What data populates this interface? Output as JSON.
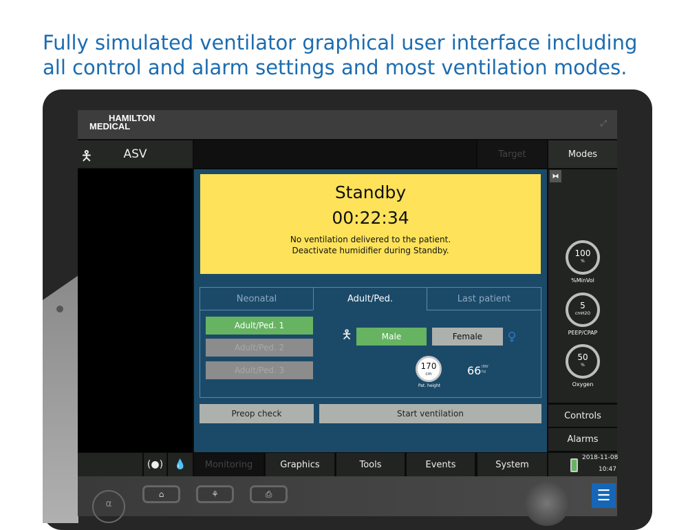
{
  "headline": "Fully simulated ventilator graphical user interface including all control and alarm settings and most ventilation modes.",
  "logo": {
    "line1": "HAMILTON",
    "line2": "MEDICAL"
  },
  "topbar": {
    "mode": "ASV",
    "target": "Target",
    "modes": "Modes"
  },
  "standby": {
    "title": "Standby",
    "timer": "00:22:34",
    "msg1": "No ventilation delivered to the patient.",
    "msg2": "Deactivate humidifier during Standby."
  },
  "tabs": [
    "Neonatal",
    "Adult/Ped.",
    "Last patient"
  ],
  "presets": [
    "Adult/Ped. 1",
    "Adult/Ped. 2",
    "Adult/Ped. 3"
  ],
  "gender": {
    "male": "Male",
    "female": "Female"
  },
  "height": {
    "value": "170",
    "unit": "cm",
    "label": "Pat. height"
  },
  "ibw": {
    "value": "66",
    "label": "IBW",
    "unit": "kg"
  },
  "actions": {
    "preop": "Preop check",
    "start": "Start ventilation"
  },
  "gauges": [
    {
      "value": "100",
      "unit": "%",
      "label": "%MinVol"
    },
    {
      "value": "5",
      "unit": "cmH2O",
      "label": "PEEP/CPAP"
    },
    {
      "value": "50",
      "unit": "%",
      "label": "Oxygen"
    }
  ],
  "side": {
    "controls": "Controls",
    "alarms": "Alarms",
    "date": "2018-11-08",
    "time": "10:47"
  },
  "nav": [
    "Monitoring",
    "Graphics",
    "Tools",
    "Events",
    "System"
  ],
  "colors": {
    "accent": "#1c6cb0",
    "standby": "#fde25a",
    "selected": "#66b462",
    "panel": "#1b4a69"
  }
}
